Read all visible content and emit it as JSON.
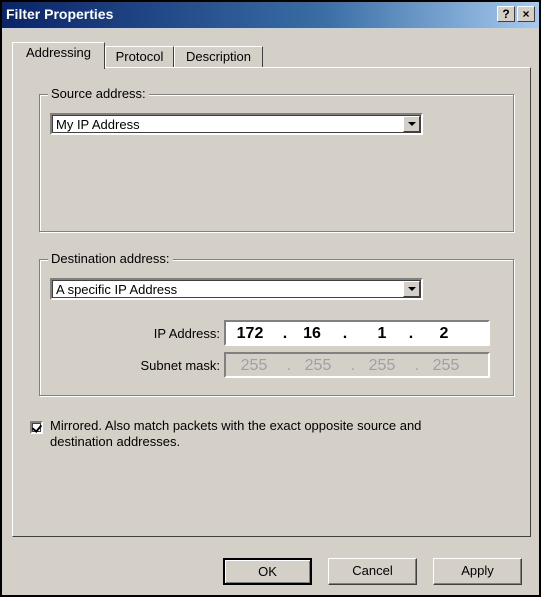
{
  "window": {
    "title": "Filter Properties",
    "help_label": "?",
    "close_label": "×"
  },
  "tabs": [
    {
      "label": "Addressing",
      "active": true
    },
    {
      "label": "Protocol",
      "active": false
    },
    {
      "label": "Description",
      "active": false
    }
  ],
  "source": {
    "group_label": "Source address:",
    "selected": "My IP Address"
  },
  "destination": {
    "group_label": "Destination address:",
    "selected": "A specific IP Address",
    "ip_label": "IP Address:",
    "ip_octets": [
      "172",
      "16",
      "1",
      "2"
    ],
    "mask_label": "Subnet mask:",
    "mask_octets": [
      "255",
      "255",
      "255",
      "255"
    ]
  },
  "mirrored": {
    "checked": true,
    "label": "Mirrored. Also match packets with the exact opposite source and destination addresses."
  },
  "buttons": {
    "ok": "OK",
    "cancel": "Cancel",
    "apply": "Apply"
  }
}
